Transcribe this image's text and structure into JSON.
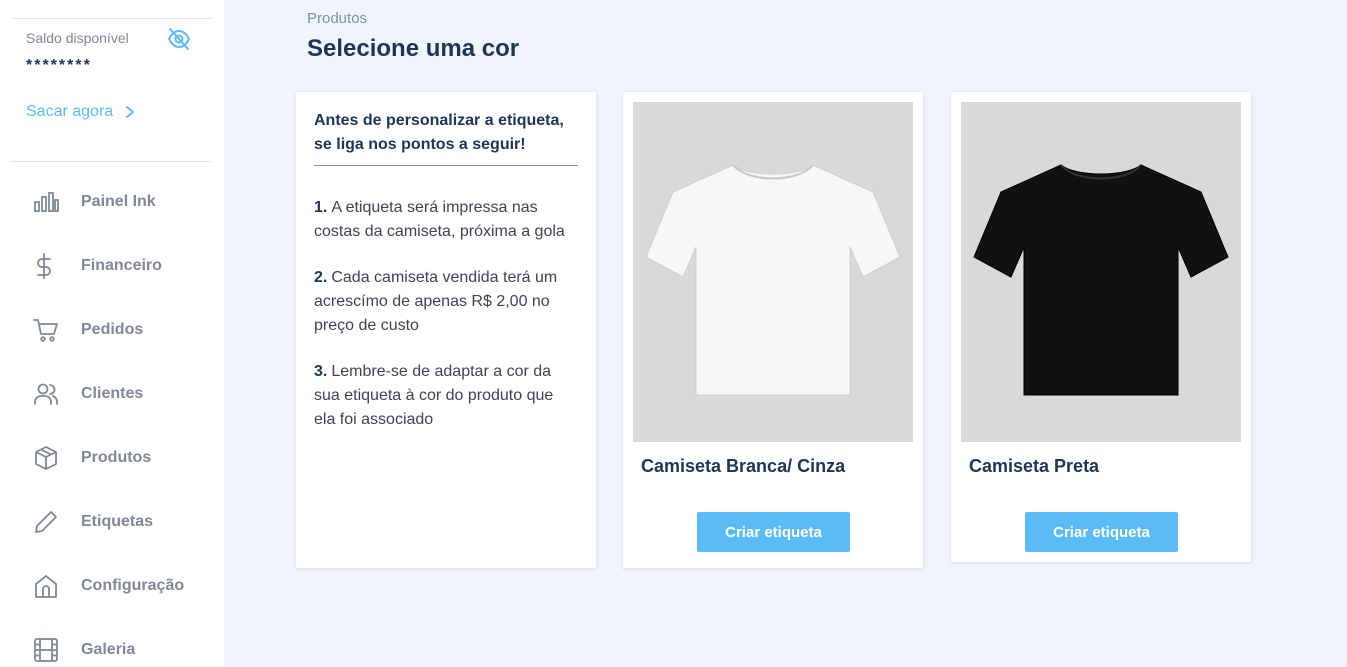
{
  "sidebar": {
    "balance_label": "Saldo disponível",
    "balance_value": "********",
    "withdraw_label": "Sacar agora",
    "items": [
      {
        "label": "Painel Ink",
        "icon": "chart-bars-icon"
      },
      {
        "label": "Financeiro",
        "icon": "dollar-icon"
      },
      {
        "label": "Pedidos",
        "icon": "cart-icon"
      },
      {
        "label": "Clientes",
        "icon": "users-icon"
      },
      {
        "label": "Produtos",
        "icon": "box-icon"
      },
      {
        "label": "Etiquetas",
        "icon": "pencil-icon"
      },
      {
        "label": "Configuração",
        "icon": "home-icon"
      },
      {
        "label": "Galeria",
        "icon": "film-icon"
      }
    ]
  },
  "main": {
    "breadcrumb": "Produtos",
    "title": "Selecione uma cor",
    "info": {
      "title": "Antes de personalizar a etiqueta, se liga nos pontos a seguir!",
      "items": [
        {
          "num": "1.",
          "text": "A etiqueta será impressa nas costas da camiseta, próxima a gola"
        },
        {
          "num": "2.",
          "text": "Cada camiseta vendida terá um acrescímo de apenas R$ 2,00 no preço de custo"
        },
        {
          "num": "3.",
          "text": "Lembre-se de adaptar a cor da sua etiqueta à cor do produto que ela foi associado"
        }
      ]
    },
    "products": [
      {
        "name": "Camiseta Branca/ Cinza",
        "button": "Criar etiqueta",
        "shirt_color": "#f7f7f7"
      },
      {
        "name": "Camiseta Preta",
        "button": "Criar etiqueta",
        "shirt_color": "#111111"
      }
    ]
  },
  "colors": {
    "accent": "#5bbcf5",
    "text_dark": "#1d3557",
    "background": "#f0f5fc"
  }
}
